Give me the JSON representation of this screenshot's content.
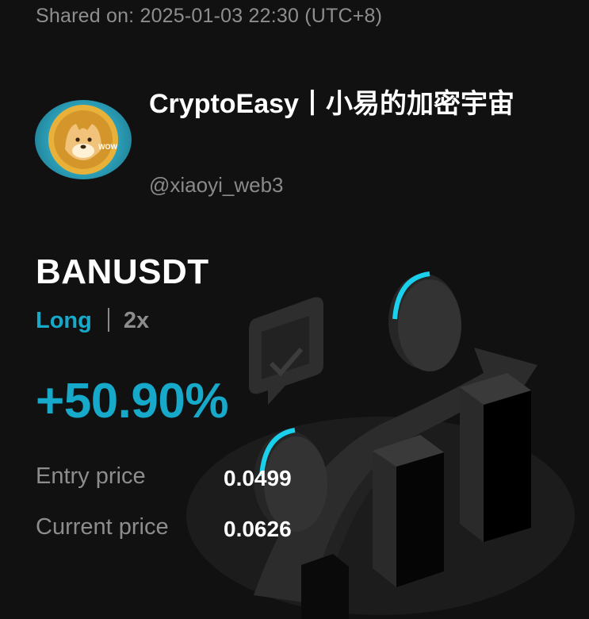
{
  "shared_on": "Shared on: 2025-01-03 22:30 (UTC+8)",
  "author": {
    "name": "CryptoEasy丨小易的加密宇宙",
    "handle": "@xiaoyi_web3",
    "avatar_text": "WOW"
  },
  "position": {
    "symbol": "BANUSDT",
    "side": "Long",
    "leverage": "2x",
    "pnl_percent": "+50.90%",
    "entry_label": "Entry price",
    "entry_value": "0.0499",
    "current_label": "Current price",
    "current_value": "0.0626"
  },
  "colors": {
    "accent": "#17a9c9",
    "background": "#111111",
    "muted_text": "#8d8d8d"
  }
}
